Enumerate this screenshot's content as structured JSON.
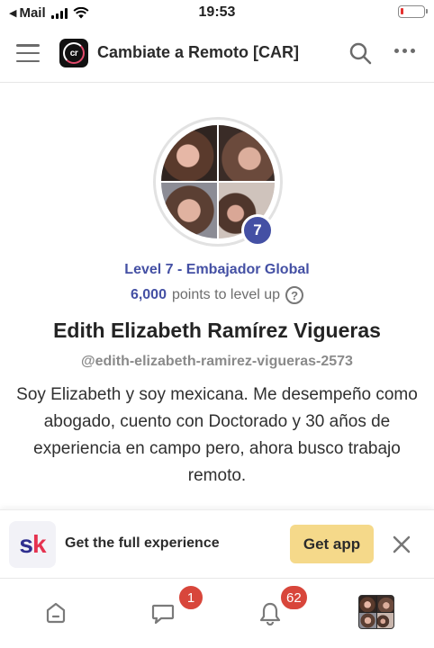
{
  "status_bar": {
    "back_label": "◀",
    "carrier": "Mail",
    "time": "19:53",
    "battery_level": 0.12,
    "battery_color": "#e5322f"
  },
  "header": {
    "logo_text": "cr",
    "title": "Cambiate a Remoto [CAR]",
    "menu_icon": "hamburger-icon",
    "search_icon": "search-icon",
    "more_icon": "more-horizontal-icon"
  },
  "profile": {
    "level_number": "7",
    "level_name": "Level 7 - Embajador Global",
    "points_value": "6,000",
    "points_suffix": "points to level up",
    "help_symbol": "?",
    "name": "Edith Elizabeth Ramírez Vigueras",
    "username": "@edith-elizabeth-ramirez-vigueras-2573",
    "bio": "Soy Elizabeth y soy mexicana. Me desempeño como abogado, cuento con Doctorado y 30 años de experiencia en campo pero, ahora busco trabajo remoto."
  },
  "banner": {
    "logo_s": "s",
    "logo_k": "k",
    "text": "Get the full experience",
    "button_label": "Get app",
    "close_icon": "close-icon",
    "button_color": "#f5d98a"
  },
  "bottom_nav": {
    "items": [
      {
        "icon": "home-icon",
        "badge": ""
      },
      {
        "icon": "chat-icon",
        "badge": "1"
      },
      {
        "icon": "bell-icon",
        "badge": "62"
      },
      {
        "icon": "profile-avatar",
        "badge": ""
      }
    ]
  },
  "colors": {
    "accent": "#4450a4",
    "badge": "#d8463b"
  }
}
